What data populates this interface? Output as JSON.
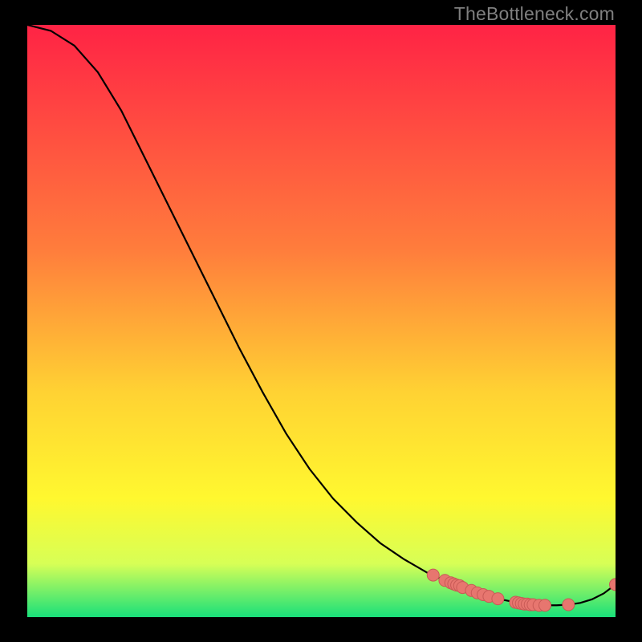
{
  "watermark": "TheBottleneck.com",
  "colors": {
    "background": "#000000",
    "grad_top": "#ff2345",
    "grad_mid_upper": "#ff7d3c",
    "grad_mid": "#ffd233",
    "grad_mid_lower": "#fff82f",
    "grad_low": "#d7ff56",
    "grad_bottom": "#19e07a",
    "curve": "#000000",
    "marker_fill": "#e7766f",
    "marker_stroke": "#c85a56"
  },
  "chart_data": {
    "type": "line",
    "x": [
      0.0,
      0.04,
      0.08,
      0.12,
      0.16,
      0.2,
      0.24,
      0.28,
      0.32,
      0.36,
      0.4,
      0.44,
      0.48,
      0.52,
      0.56,
      0.6,
      0.64,
      0.68,
      0.7,
      0.72,
      0.74,
      0.76,
      0.78,
      0.8,
      0.82,
      0.84,
      0.86,
      0.88,
      0.9,
      0.92,
      0.94,
      0.96,
      0.98,
      1.0
    ],
    "values": [
      1.0,
      0.99,
      0.965,
      0.92,
      0.855,
      0.775,
      0.695,
      0.615,
      0.535,
      0.455,
      0.38,
      0.31,
      0.25,
      0.2,
      0.16,
      0.125,
      0.098,
      0.075,
      0.066,
      0.058,
      0.05,
      0.043,
      0.037,
      0.031,
      0.027,
      0.023,
      0.021,
      0.02,
      0.02,
      0.021,
      0.024,
      0.03,
      0.04,
      0.055
    ],
    "markers": [
      {
        "x": 0.69,
        "y": 0.071
      },
      {
        "x": 0.71,
        "y": 0.062
      },
      {
        "x": 0.72,
        "y": 0.058
      },
      {
        "x": 0.725,
        "y": 0.056
      },
      {
        "x": 0.73,
        "y": 0.054
      },
      {
        "x": 0.735,
        "y": 0.053
      },
      {
        "x": 0.74,
        "y": 0.05
      },
      {
        "x": 0.755,
        "y": 0.045
      },
      {
        "x": 0.765,
        "y": 0.041
      },
      {
        "x": 0.775,
        "y": 0.038
      },
      {
        "x": 0.785,
        "y": 0.035
      },
      {
        "x": 0.8,
        "y": 0.031
      },
      {
        "x": 0.83,
        "y": 0.025
      },
      {
        "x": 0.835,
        "y": 0.024
      },
      {
        "x": 0.84,
        "y": 0.023
      },
      {
        "x": 0.845,
        "y": 0.022
      },
      {
        "x": 0.85,
        "y": 0.022
      },
      {
        "x": 0.855,
        "y": 0.021
      },
      {
        "x": 0.86,
        "y": 0.021
      },
      {
        "x": 0.87,
        "y": 0.02
      },
      {
        "x": 0.88,
        "y": 0.02
      },
      {
        "x": 0.92,
        "y": 0.021
      },
      {
        "x": 1.0,
        "y": 0.055
      }
    ],
    "title": "",
    "xlabel": "",
    "ylabel": "",
    "xlim": [
      0,
      1
    ],
    "ylim": [
      0,
      1
    ]
  }
}
